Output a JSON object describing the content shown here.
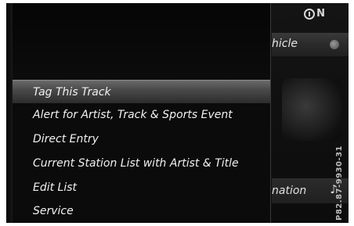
{
  "status": {
    "indicator_letter": "N"
  },
  "background": {
    "vehicle_label": "hicle",
    "navigation_label": "nation"
  },
  "menu": {
    "items": [
      {
        "label": "Tag This Track",
        "selected": true
      },
      {
        "label": "Alert for Artist, Track & Sports Event",
        "selected": false
      },
      {
        "label": "Direct Entry",
        "selected": false
      },
      {
        "label": "Current Station List with Artist & Title",
        "selected": false
      },
      {
        "label": "Edit List",
        "selected": false
      },
      {
        "label": "Service",
        "selected": false
      }
    ]
  },
  "figure_code": "P82.87-9930-31",
  "icons": {
    "status_circle": "circle-indicator-icon",
    "vehicle_dot": "dot-indicator-icon",
    "music": "music-note-icon"
  },
  "colors": {
    "screen_background": "#050505",
    "selection_highlight": "#5a5a5a",
    "text": "#f0f0f0"
  }
}
